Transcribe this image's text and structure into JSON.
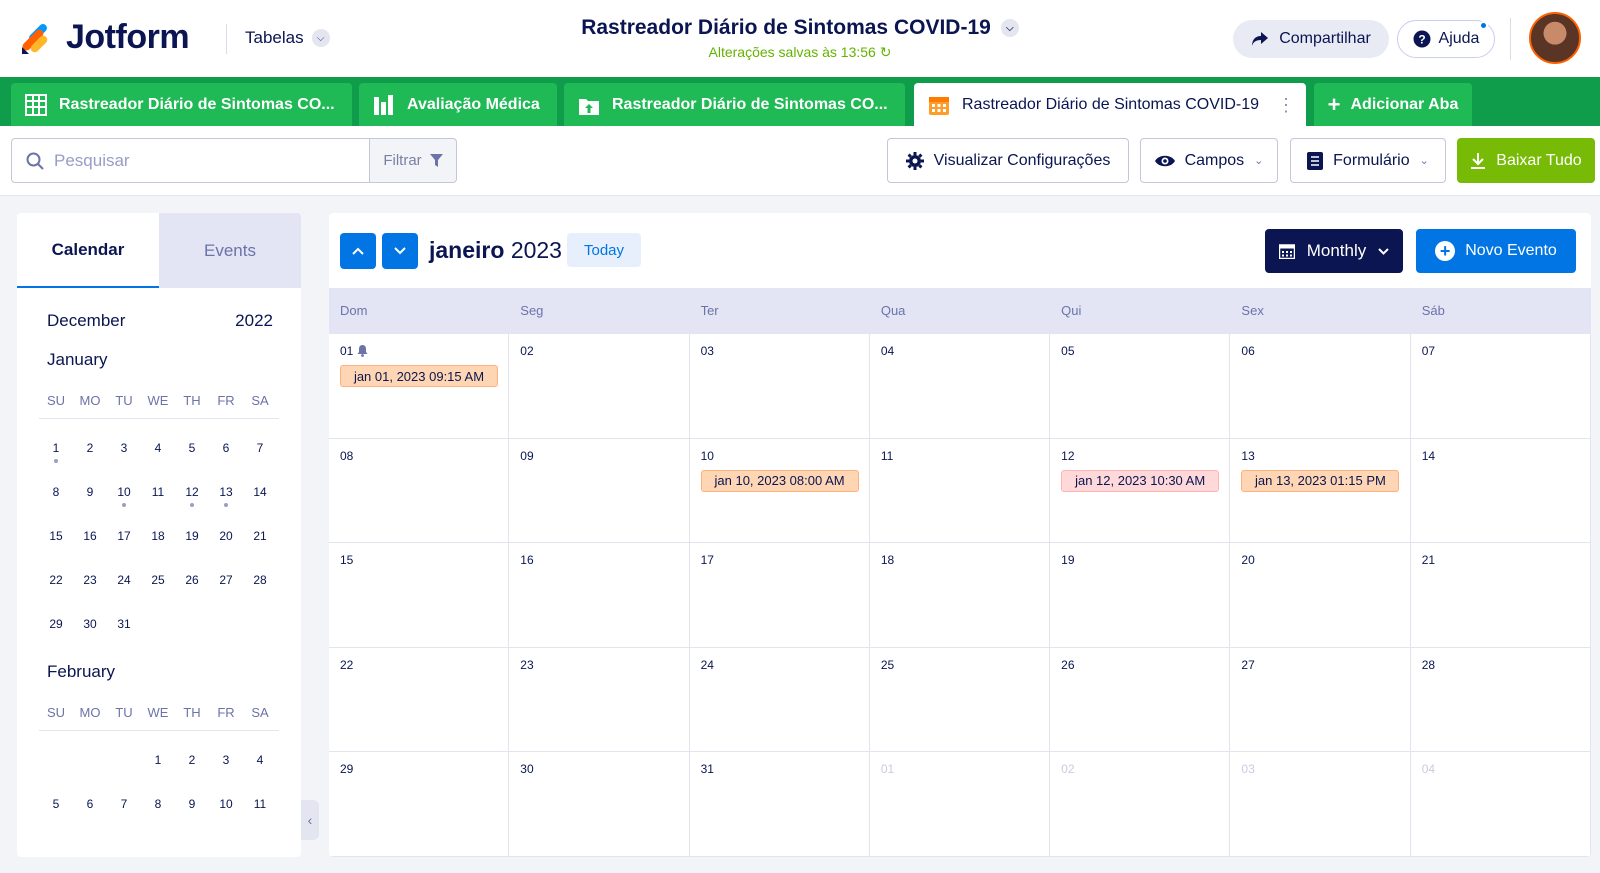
{
  "header": {
    "logo_text": "Jotform",
    "tables_label": "Tabelas",
    "doc_title": "Rastreador Diário de Sintomas COVID-19",
    "saved_status": "Alterações salvas às 13:56",
    "share_label": "Compartilhar",
    "help_label": "Ajuda"
  },
  "tabs": [
    {
      "label": "Rastreador Diário de Sintomas CO...",
      "icon": "grid-icon"
    },
    {
      "label": "Avaliação Médica",
      "icon": "report-icon"
    },
    {
      "label": "Rastreador Diário de Sintomas CO...",
      "icon": "upload-folder-icon"
    },
    {
      "label": "Rastreador Diário de Sintomas COVID-19",
      "icon": "calendar-icon"
    }
  ],
  "add_tab_label": "Adicionar Aba",
  "toolbar": {
    "search_placeholder": "Pesquisar",
    "filter_label": "Filtrar",
    "view_settings_label": "Visualizar Configurações",
    "fields_label": "Campos",
    "form_label": "Formulário",
    "download_label": "Baixar Tudo"
  },
  "sidebar": {
    "tab_calendar": "Calendar",
    "tab_events": "Events",
    "header_month": "December",
    "header_year": "2022",
    "weekdays": [
      "SU",
      "MO",
      "TU",
      "WE",
      "TH",
      "FR",
      "SA"
    ],
    "january": {
      "name": "January",
      "weeks": [
        [
          "1",
          "2",
          "3",
          "4",
          "5",
          "6",
          "7"
        ],
        [
          "8",
          "9",
          "10",
          "11",
          "12",
          "13",
          "14"
        ],
        [
          "15",
          "16",
          "17",
          "18",
          "19",
          "20",
          "21"
        ],
        [
          "22",
          "23",
          "24",
          "25",
          "26",
          "27",
          "28"
        ],
        [
          "29",
          "30",
          "31",
          "",
          "",
          "",
          ""
        ]
      ],
      "event_days": [
        "1",
        "10",
        "12",
        "13"
      ]
    },
    "february": {
      "name": "February",
      "weeks": [
        [
          "",
          "",
          "",
          "1",
          "2",
          "3",
          "4"
        ],
        [
          "5",
          "6",
          "7",
          "8",
          "9",
          "10",
          "11"
        ]
      ]
    }
  },
  "calendar": {
    "month_name": "janeiro",
    "year": "2023",
    "today_label": "Today",
    "view_label": "Monthly",
    "new_event_label": "Novo Evento",
    "day_headers": [
      "Dom",
      "Seg",
      "Ter",
      "Qua",
      "Qui",
      "Sex",
      "Sáb"
    ],
    "weeks": [
      [
        {
          "d": "01",
          "bell": true
        },
        {
          "d": "02"
        },
        {
          "d": "03"
        },
        {
          "d": "04"
        },
        {
          "d": "05"
        },
        {
          "d": "06"
        },
        {
          "d": "07"
        }
      ],
      [
        {
          "d": "08"
        },
        {
          "d": "09"
        },
        {
          "d": "10"
        },
        {
          "d": "11"
        },
        {
          "d": "12"
        },
        {
          "d": "13"
        },
        {
          "d": "14"
        }
      ],
      [
        {
          "d": "15"
        },
        {
          "d": "16"
        },
        {
          "d": "17"
        },
        {
          "d": "18"
        },
        {
          "d": "19"
        },
        {
          "d": "20"
        },
        {
          "d": "21"
        }
      ],
      [
        {
          "d": "22"
        },
        {
          "d": "23"
        },
        {
          "d": "24"
        },
        {
          "d": "25"
        },
        {
          "d": "26"
        },
        {
          "d": "27"
        },
        {
          "d": "28"
        }
      ],
      [
        {
          "d": "29"
        },
        {
          "d": "30"
        },
        {
          "d": "31"
        },
        {
          "d": "01",
          "other": true
        },
        {
          "d": "02",
          "other": true
        },
        {
          "d": "03",
          "other": true
        },
        {
          "d": "04",
          "other": true
        }
      ]
    ],
    "events": [
      {
        "week": 0,
        "day": 0,
        "label": "jan 01, 2023 09:15 AM",
        "color": "orange"
      },
      {
        "week": 1,
        "day": 2,
        "label": "jan 10, 2023 08:00 AM",
        "color": "orange"
      },
      {
        "week": 1,
        "day": 4,
        "label": "jan 12, 2023 10:30 AM",
        "color": "pink"
      },
      {
        "week": 1,
        "day": 5,
        "label": "jan 13, 2023 01:15 PM",
        "color": "orange"
      }
    ]
  },
  "colors": {
    "brand_green": "#0f9d4c",
    "accent_blue": "#0075e3",
    "navy": "#0a1551",
    "download_green": "#78bb07"
  }
}
